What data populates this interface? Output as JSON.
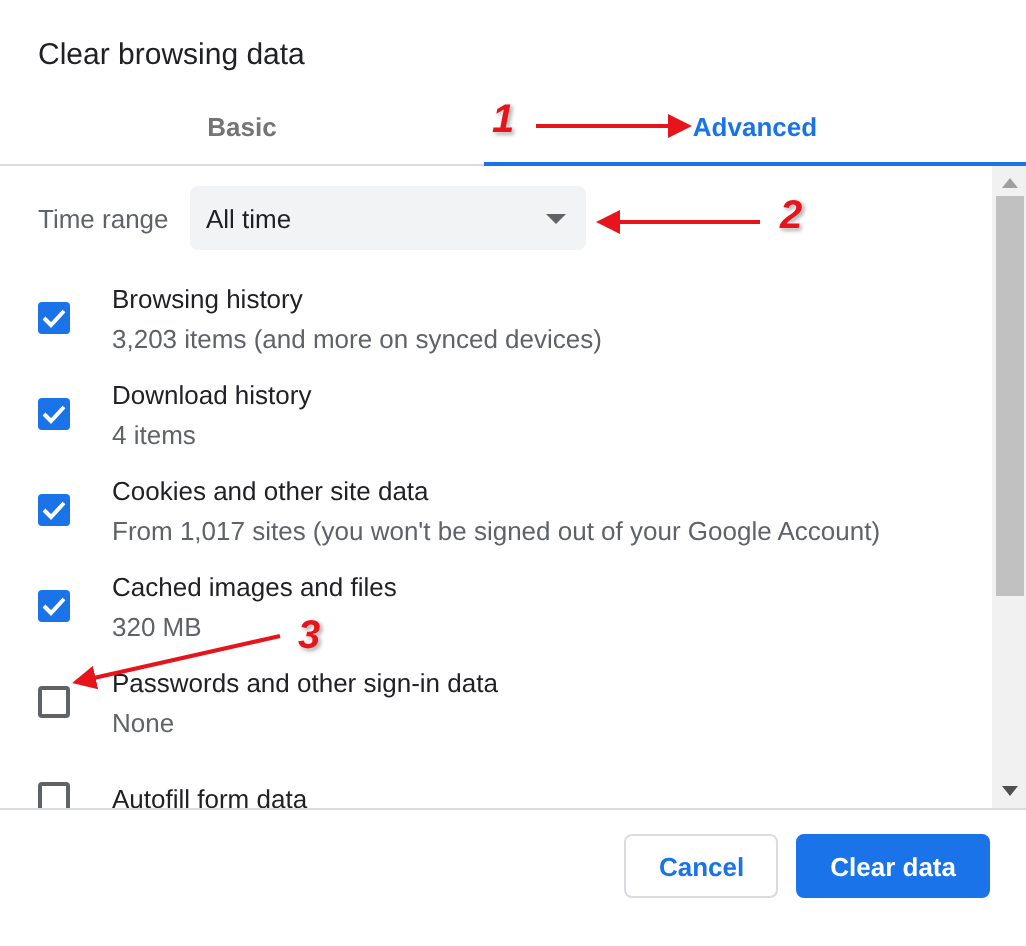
{
  "dialog": {
    "title": "Clear browsing data"
  },
  "tabs": [
    {
      "label": "Basic",
      "selected": false
    },
    {
      "label": "Advanced",
      "selected": true
    }
  ],
  "time_range": {
    "label": "Time range",
    "value": "All time"
  },
  "items": [
    {
      "label": "Browsing history",
      "detail": "3,203 items (and more on synced devices)",
      "checked": true
    },
    {
      "label": "Download history",
      "detail": "4 items",
      "checked": true
    },
    {
      "label": "Cookies and other site data",
      "detail": "From 1,017 sites (you won't be signed out of your Google Account)",
      "checked": true
    },
    {
      "label": "Cached images and files",
      "detail": "320 MB",
      "checked": true
    },
    {
      "label": "Passwords and other sign-in data",
      "detail": "None",
      "checked": false
    },
    {
      "label": "Autofill form data",
      "checked": false
    }
  ],
  "buttons": [
    {
      "label": "Cancel",
      "kind": "secondary"
    },
    {
      "label": "Clear data",
      "kind": "primary"
    }
  ],
  "annotations": [
    {
      "number": "1"
    },
    {
      "number": "2"
    },
    {
      "number": "3"
    }
  ]
}
